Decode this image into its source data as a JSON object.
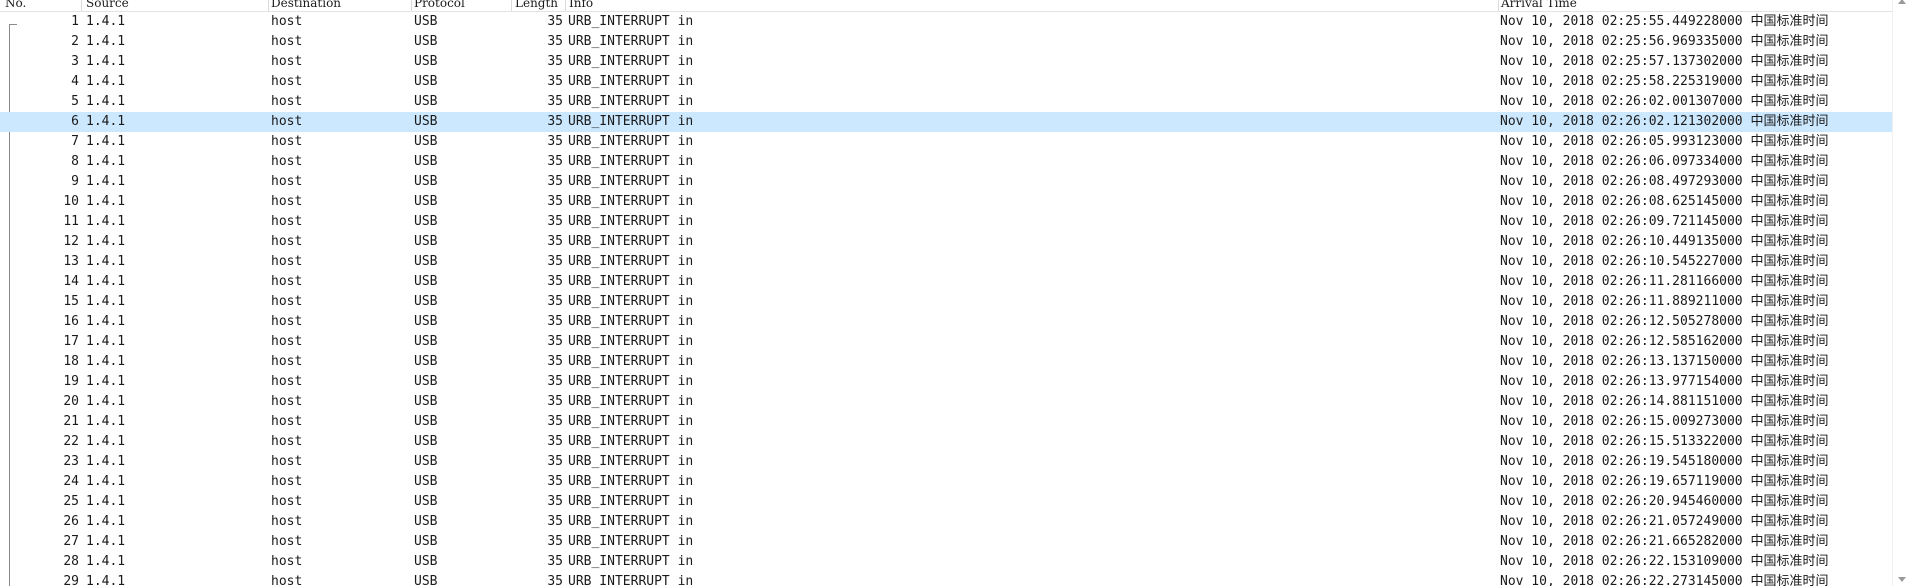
{
  "columns": {
    "no": "No.",
    "source": "Source",
    "destination": "Destination",
    "protocol": "Protocol",
    "length": "Length",
    "info": "Info",
    "arrival_time": "Arrival Time"
  },
  "selected_row": 6,
  "packets": [
    {
      "no": "1",
      "source": "1.4.1",
      "destination": "host",
      "protocol": "USB",
      "length": "35",
      "info": "URB_INTERRUPT in",
      "time": "Nov 10, 2018 02:25:55.449228000 中国标准时间"
    },
    {
      "no": "2",
      "source": "1.4.1",
      "destination": "host",
      "protocol": "USB",
      "length": "35",
      "info": "URB_INTERRUPT in",
      "time": "Nov 10, 2018 02:25:56.969335000 中国标准时间"
    },
    {
      "no": "3",
      "source": "1.4.1",
      "destination": "host",
      "protocol": "USB",
      "length": "35",
      "info": "URB_INTERRUPT in",
      "time": "Nov 10, 2018 02:25:57.137302000 中国标准时间"
    },
    {
      "no": "4",
      "source": "1.4.1",
      "destination": "host",
      "protocol": "USB",
      "length": "35",
      "info": "URB_INTERRUPT in",
      "time": "Nov 10, 2018 02:25:58.225319000 中国标准时间"
    },
    {
      "no": "5",
      "source": "1.4.1",
      "destination": "host",
      "protocol": "USB",
      "length": "35",
      "info": "URB_INTERRUPT in",
      "time": "Nov 10, 2018 02:26:02.001307000 中国标准时间"
    },
    {
      "no": "6",
      "source": "1.4.1",
      "destination": "host",
      "protocol": "USB",
      "length": "35",
      "info": "URB_INTERRUPT in",
      "time": "Nov 10, 2018 02:26:02.121302000 中国标准时间"
    },
    {
      "no": "7",
      "source": "1.4.1",
      "destination": "host",
      "protocol": "USB",
      "length": "35",
      "info": "URB_INTERRUPT in",
      "time": "Nov 10, 2018 02:26:05.993123000 中国标准时间"
    },
    {
      "no": "8",
      "source": "1.4.1",
      "destination": "host",
      "protocol": "USB",
      "length": "35",
      "info": "URB_INTERRUPT in",
      "time": "Nov 10, 2018 02:26:06.097334000 中国标准时间"
    },
    {
      "no": "9",
      "source": "1.4.1",
      "destination": "host",
      "protocol": "USB",
      "length": "35",
      "info": "URB_INTERRUPT in",
      "time": "Nov 10, 2018 02:26:08.497293000 中国标准时间"
    },
    {
      "no": "10",
      "source": "1.4.1",
      "destination": "host",
      "protocol": "USB",
      "length": "35",
      "info": "URB_INTERRUPT in",
      "time": "Nov 10, 2018 02:26:08.625145000 中国标准时间"
    },
    {
      "no": "11",
      "source": "1.4.1",
      "destination": "host",
      "protocol": "USB",
      "length": "35",
      "info": "URB_INTERRUPT in",
      "time": "Nov 10, 2018 02:26:09.721145000 中国标准时间"
    },
    {
      "no": "12",
      "source": "1.4.1",
      "destination": "host",
      "protocol": "USB",
      "length": "35",
      "info": "URB_INTERRUPT in",
      "time": "Nov 10, 2018 02:26:10.449135000 中国标准时间"
    },
    {
      "no": "13",
      "source": "1.4.1",
      "destination": "host",
      "protocol": "USB",
      "length": "35",
      "info": "URB_INTERRUPT in",
      "time": "Nov 10, 2018 02:26:10.545227000 中国标准时间"
    },
    {
      "no": "14",
      "source": "1.4.1",
      "destination": "host",
      "protocol": "USB",
      "length": "35",
      "info": "URB_INTERRUPT in",
      "time": "Nov 10, 2018 02:26:11.281166000 中国标准时间"
    },
    {
      "no": "15",
      "source": "1.4.1",
      "destination": "host",
      "protocol": "USB",
      "length": "35",
      "info": "URB_INTERRUPT in",
      "time": "Nov 10, 2018 02:26:11.889211000 中国标准时间"
    },
    {
      "no": "16",
      "source": "1.4.1",
      "destination": "host",
      "protocol": "USB",
      "length": "35",
      "info": "URB_INTERRUPT in",
      "time": "Nov 10, 2018 02:26:12.505278000 中国标准时间"
    },
    {
      "no": "17",
      "source": "1.4.1",
      "destination": "host",
      "protocol": "USB",
      "length": "35",
      "info": "URB_INTERRUPT in",
      "time": "Nov 10, 2018 02:26:12.585162000 中国标准时间"
    },
    {
      "no": "18",
      "source": "1.4.1",
      "destination": "host",
      "protocol": "USB",
      "length": "35",
      "info": "URB_INTERRUPT in",
      "time": "Nov 10, 2018 02:26:13.137150000 中国标准时间"
    },
    {
      "no": "19",
      "source": "1.4.1",
      "destination": "host",
      "protocol": "USB",
      "length": "35",
      "info": "URB_INTERRUPT in",
      "time": "Nov 10, 2018 02:26:13.977154000 中国标准时间"
    },
    {
      "no": "20",
      "source": "1.4.1",
      "destination": "host",
      "protocol": "USB",
      "length": "35",
      "info": "URB_INTERRUPT in",
      "time": "Nov 10, 2018 02:26:14.881151000 中国标准时间"
    },
    {
      "no": "21",
      "source": "1.4.1",
      "destination": "host",
      "protocol": "USB",
      "length": "35",
      "info": "URB_INTERRUPT in",
      "time": "Nov 10, 2018 02:26:15.009273000 中国标准时间"
    },
    {
      "no": "22",
      "source": "1.4.1",
      "destination": "host",
      "protocol": "USB",
      "length": "35",
      "info": "URB_INTERRUPT in",
      "time": "Nov 10, 2018 02:26:15.513322000 中国标准时间"
    },
    {
      "no": "23",
      "source": "1.4.1",
      "destination": "host",
      "protocol": "USB",
      "length": "35",
      "info": "URB_INTERRUPT in",
      "time": "Nov 10, 2018 02:26:19.545180000 中国标准时间"
    },
    {
      "no": "24",
      "source": "1.4.1",
      "destination": "host",
      "protocol": "USB",
      "length": "35",
      "info": "URB_INTERRUPT in",
      "time": "Nov 10, 2018 02:26:19.657119000 中国标准时间"
    },
    {
      "no": "25",
      "source": "1.4.1",
      "destination": "host",
      "protocol": "USB",
      "length": "35",
      "info": "URB_INTERRUPT in",
      "time": "Nov 10, 2018 02:26:20.945460000 中国标准时间"
    },
    {
      "no": "26",
      "source": "1.4.1",
      "destination": "host",
      "protocol": "USB",
      "length": "35",
      "info": "URB_INTERRUPT in",
      "time": "Nov 10, 2018 02:26:21.057249000 中国标准时间"
    },
    {
      "no": "27",
      "source": "1.4.1",
      "destination": "host",
      "protocol": "USB",
      "length": "35",
      "info": "URB_INTERRUPT in",
      "time": "Nov 10, 2018 02:26:21.665282000 中国标准时间"
    },
    {
      "no": "28",
      "source": "1.4.1",
      "destination": "host",
      "protocol": "USB",
      "length": "35",
      "info": "URB_INTERRUPT in",
      "time": "Nov 10, 2018 02:26:22.153109000 中国标准时间"
    },
    {
      "no": "29",
      "source": "1.4.1",
      "destination": "host",
      "protocol": "USB",
      "length": "35",
      "info": "URB_INTERRUPT in",
      "time": "Nov 10, 2018 02:26:22.273145000 中国标准时间"
    }
  ]
}
